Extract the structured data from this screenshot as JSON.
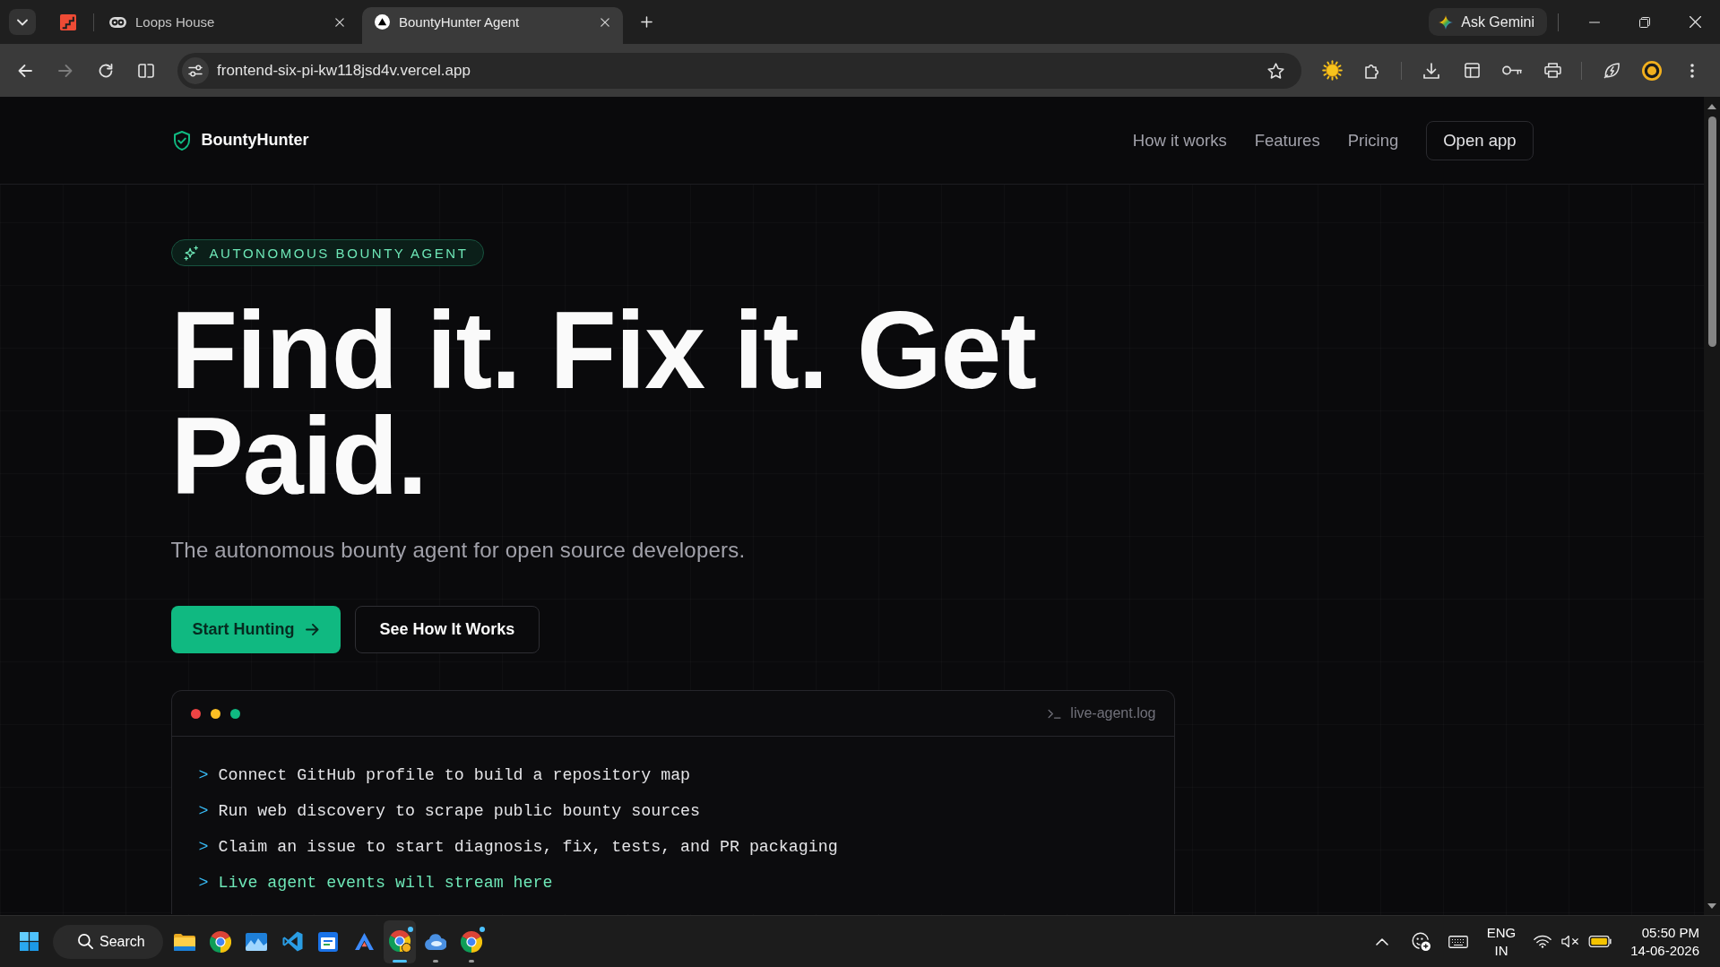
{
  "browser": {
    "tabs": [
      {
        "kind": "pinned",
        "selected": false
      },
      {
        "kind": "page",
        "title": "Loops House",
        "selected": false
      },
      {
        "kind": "page",
        "title": "BountyHunter Agent",
        "selected": true
      }
    ],
    "ask_gemini": "Ask Gemini",
    "nav_buttons": [
      {
        "kind": "back",
        "disabled": false
      },
      {
        "kind": "forward",
        "disabled": true
      },
      {
        "kind": "reload",
        "disabled": false
      },
      {
        "kind": "split_view",
        "disabled": false
      }
    ],
    "address": "frontend-six-pi-kw118jsd4v.vercel.app"
  },
  "site": {
    "brand": "BountyHunter",
    "nav_links": [
      "How it works",
      "Features",
      "Pricing"
    ],
    "nav_button": "Open app",
    "badge": "AUTONOMOUS BOUNTY AGENT",
    "headline": "Find it. Fix it. Get Paid.",
    "subtitle": "The autonomous bounty agent for open source developers.",
    "buttons": [
      {
        "kind": "primary",
        "label": "Start Hunting"
      },
      {
        "kind": "secondary",
        "label": "See How It Works"
      }
    ],
    "terminal": {
      "dots": [
        {
          "color": "#ef4444"
        },
        {
          "color": "#fbbf24"
        },
        {
          "color": "#10b981"
        }
      ],
      "filename": "live-agent.log",
      "lines": [
        {
          "kind": "step",
          "prompt": ">",
          "text": "Connect GitHub profile to build a repository map"
        },
        {
          "kind": "step",
          "prompt": ">",
          "text": "Run web discovery to scrape public bounty sources"
        },
        {
          "kind": "step",
          "prompt": ">",
          "text": "Claim an issue to start diagnosis, fix, tests, and PR packaging"
        },
        {
          "kind": "live",
          "prompt": ">",
          "text": "Live agent events will stream here"
        }
      ]
    }
  },
  "taskbar": {
    "search": "Search",
    "apps": [
      {
        "kind": "explorer",
        "running": false,
        "active": false,
        "badge": false
      },
      {
        "kind": "chrome",
        "running": false,
        "active": false,
        "badge": false
      },
      {
        "kind": "photos",
        "running": false,
        "active": false,
        "badge": false
      },
      {
        "kind": "code",
        "running": false,
        "active": false,
        "badge": false
      },
      {
        "kind": "calendar",
        "running": false,
        "active": false,
        "badge": false
      },
      {
        "kind": "peak",
        "running": false,
        "active": false,
        "badge": false
      },
      {
        "kind": "chrome_profile",
        "running": true,
        "active": true,
        "badge": true
      },
      {
        "kind": "cloud",
        "running": true,
        "active": false,
        "badge": false
      },
      {
        "kind": "chrome",
        "running": true,
        "active": false,
        "badge": true
      }
    ],
    "language": "ENG",
    "region": "IN",
    "volume_muted": true,
    "time": "05:50 PM",
    "date": "14-06-2026"
  }
}
